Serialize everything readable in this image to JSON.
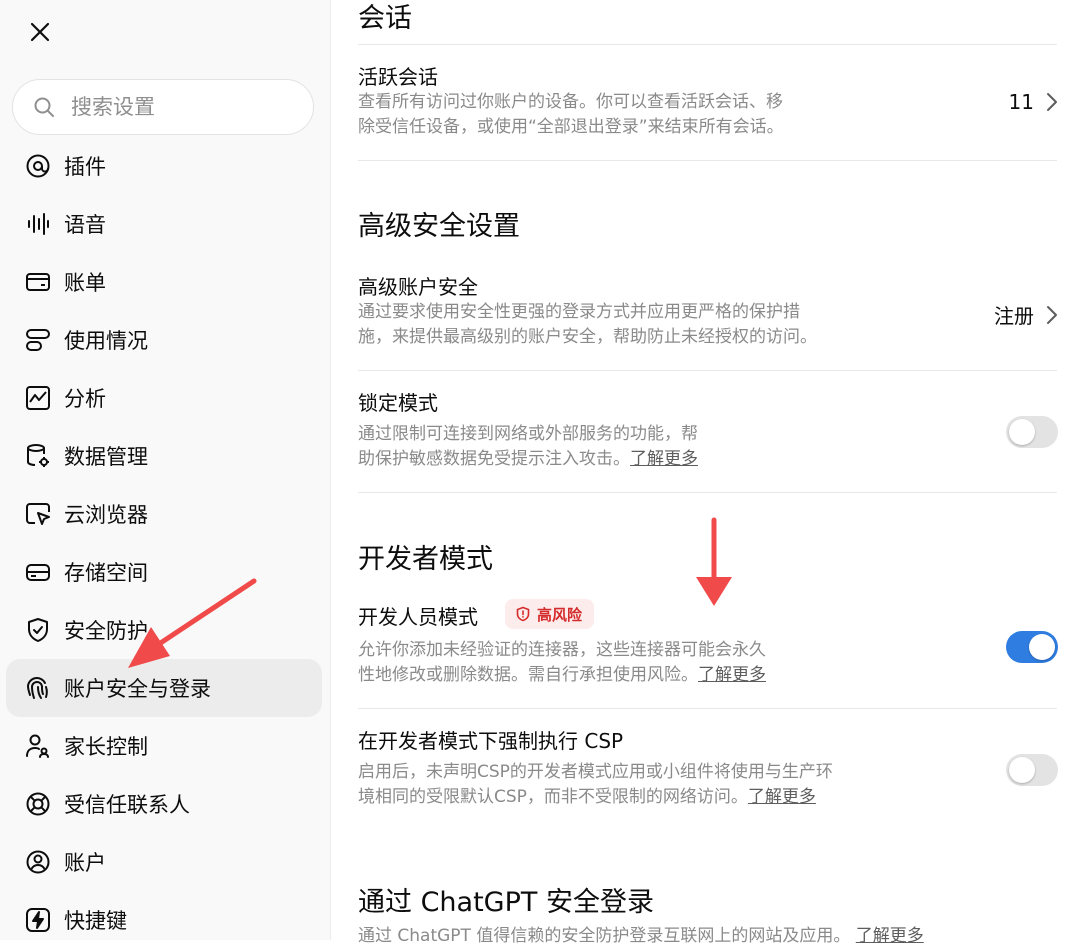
{
  "sidebar": {
    "search_placeholder": "搜索设置",
    "active_item": "账户安全与登录",
    "items": [
      {
        "label": "插件",
        "icon": "plugin-icon"
      },
      {
        "label": "语音",
        "icon": "voice-wave-icon"
      },
      {
        "label": "账单",
        "icon": "billing-card-icon"
      },
      {
        "label": "使用情况",
        "icon": "usage-icon"
      },
      {
        "label": "分析",
        "icon": "analytics-chart-icon"
      },
      {
        "label": "数据管理",
        "icon": "database-gear-icon"
      },
      {
        "label": "云浏览器",
        "icon": "cloud-browser-icon"
      },
      {
        "label": "存储空间",
        "icon": "storage-drive-icon"
      },
      {
        "label": "安全防护",
        "icon": "shield-check-icon"
      },
      {
        "label": "账户安全与登录",
        "icon": "fingerprint-icon"
      },
      {
        "label": "家长控制",
        "icon": "parental-control-icon"
      },
      {
        "label": "受信任联系人",
        "icon": "lifebuoy-icon"
      },
      {
        "label": "账户",
        "icon": "account-avatar-icon"
      },
      {
        "label": "快捷键",
        "icon": "keyboard-shortcut-icon"
      }
    ]
  },
  "main": {
    "sessions": {
      "title": "会话",
      "active_sessions": {
        "title": "活跃会话",
        "desc_line1": "查看所有访问过你账户的设备。你可以查看活跃会话、移",
        "desc_line2": "除受信任设备，或使用“全部退出登录”来结束所有会话。",
        "count": "11"
      }
    },
    "advanced": {
      "title": "高级安全设置",
      "account_security": {
        "title": "高级账户安全",
        "desc_line1": "通过要求使用安全性更强的登录方式并应用更严格的保护措",
        "desc_line2": "施，来提供最高级别的账户安全，帮助防止未经授权的访问。",
        "action": "注册"
      },
      "lockdown": {
        "title": "锁定模式",
        "desc_line1": "通过限制可连接到网络或外部服务的功能，帮",
        "desc_line2": "助保护敏感数据免受提示注入攻击。",
        "learn_more": "了解更多",
        "enabled": false
      }
    },
    "developer": {
      "title": "开发者模式",
      "dev_mode": {
        "title": "开发人员模式",
        "badge": "高风险",
        "desc_line1": "允许你添加未经验证的连接器，这些连接器可能会永久",
        "desc_line2": "性地修改或删除数据。需自行承担使用风险。",
        "learn_more": "了解更多",
        "enabled": true
      },
      "csp": {
        "title": "在开发者模式下强制执行 CSP",
        "desc_line1": "启用后，未声明CSP的开发者模式应用或小组件将使用与生产环",
        "desc_line2": "境相同的受限默认CSP，而非不受限制的网络访问。",
        "learn_more": "了解更多",
        "enabled": false
      }
    },
    "chatgpt_login": {
      "title": "通过 ChatGPT 安全登录",
      "desc_partial": "通过 ChatGPT 值得信赖的安全防护登录互联网上的网站及应用。",
      "learn_more": "了解更多"
    }
  },
  "colors": {
    "accent": "#2f7de1",
    "danger": "#d42c2c",
    "annotation_arrow": "#f04a4a"
  }
}
